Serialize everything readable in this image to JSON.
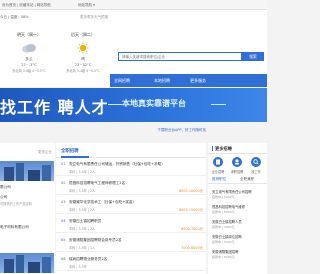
{
  "topbar": {
    "item1": "设为首页 | 收藏本站 | 网站导航",
    "item2": "网站导航 ▾"
  },
  "weather": {
    "header": "今日 | 温度：58%",
    "more": "更多更多天气预报",
    "days": [
      {
        "label": "明天（周一）",
        "icon": "cloudy-icon",
        "cond": "多云",
        "temp": "27~-3°C",
        "wind": "东北风 3-4级 4~5.5°C"
      },
      {
        "label": "后天（周二）",
        "icon": "sunny-icon",
        "cond": "晴",
        "temp": "23~32°C",
        "wind": "东北风 3-4级 4~5.5°C"
      }
    ]
  },
  "search": {
    "placeholder": "请输入关键词搜索职位/企业",
    "button": "搜索"
  },
  "nav": {
    "items": [
      "全网招聘",
      "本地招聘",
      "更多服务"
    ]
  },
  "banner": {
    "title": "找工作 聘人才",
    "subtitle": "本地真实靠谱平台"
  },
  "download_note": "下载职业台APP，好工作随时找",
  "left_column": {
    "more": "更多企业",
    "items": [
      {
        "name": "限公司",
        "sub": ""
      },
      {
        "name": "公司",
        "sub": "可提供的工作产品定制"
      },
      {
        "name": "电子材料有限公司",
        "sub": ""
      },
      {
        "name": "",
        "sub": ""
      }
    ]
  },
  "main_column": {
    "tab": "全职招聘",
    "jobs": [
      {
        "num": "01",
        "title": "安立电气有限责任公司储运，外贸销售（社保+包吃+补助）",
        "meta": "本科 | 3-5年 | 2人",
        "salary": ""
      },
      {
        "num": "02",
        "title": "恒昌科技招聘电气工程师修理工2名",
        "meta": "本科 | 3-5年 | 2人",
        "salary": "6000-10000元"
      },
      {
        "num": "03",
        "title": "安徽威华化学技术工（社保+包吃+奖金）",
        "meta": "本科 | 3-5年 | 2人",
        "salary": "8000-15000元"
      },
      {
        "num": "04",
        "title": "安徽白土镇招聘职员",
        "meta": "本科 | 3-5年 | 2人",
        "salary": "8000-7000元"
      },
      {
        "num": "05",
        "title": "安徽浦翔集团招聘财会岗专员2名",
        "meta": "本科 | 3-5年 | 1人",
        "salary": "7000-8500元"
      },
      {
        "num": "06",
        "title": "瑞尚招聘物业服务员2名",
        "meta": "本科 | 3-5年",
        "salary": ""
      }
    ]
  },
  "right_column": {
    "header": "更多招聘",
    "actions": [
      "企业招聘",
      "求职招聘",
      "找工作"
    ],
    "tabs": [
      "推荐职位",
      "全职兼职"
    ],
    "items": [
      {
        "title": "安立电气有限责任公司招聘",
        "sub": "招聘中 | 5000元"
      },
      {
        "title": "恒昌科技招聘电气维修",
        "sub": "招聘中 | 6000元"
      },
      {
        "title": "安徽白土镇招聘人员",
        "sub": "招聘中 | 4000元"
      },
      {
        "title": "安徽白土镇岗位招聘",
        "sub": "招聘中 | 5000元"
      },
      {
        "title": "安徽浦翔集团招聘",
        "sub": "招聘中 | 5000元"
      }
    ]
  }
}
